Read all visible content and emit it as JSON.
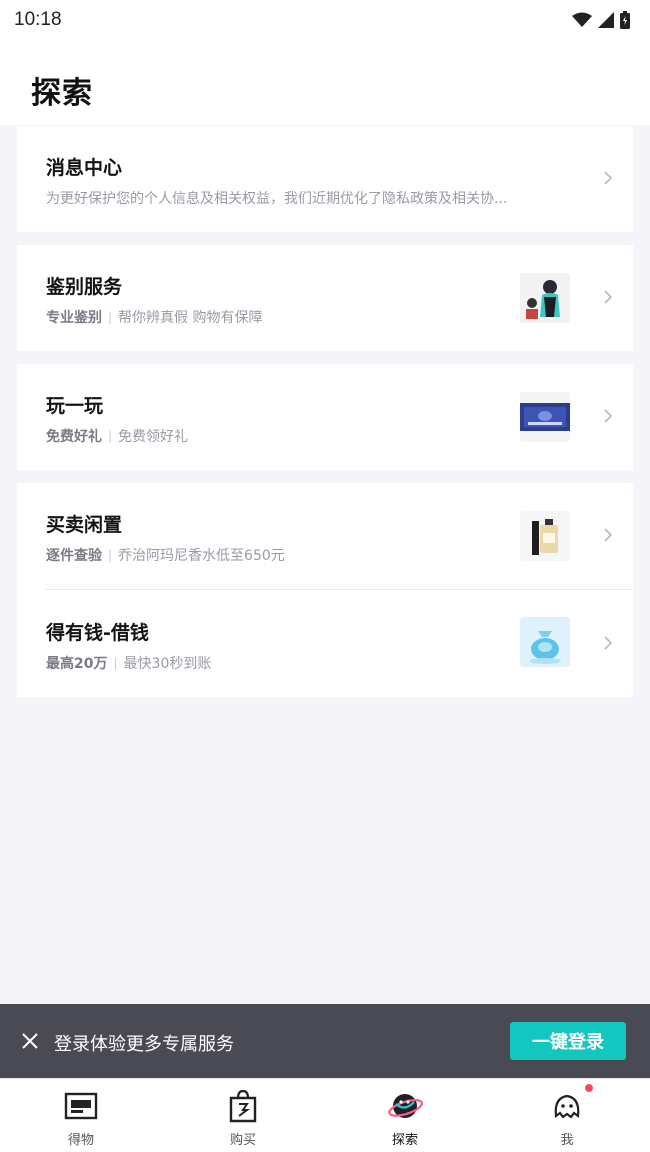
{
  "status_bar": {
    "time": "10:18"
  },
  "header": {
    "title": "探索"
  },
  "rows": [
    {
      "title": "消息中心",
      "subtitle": "为更好保护您的个人信息及相关权益，我们近期优化了隐私政策及相关协...",
      "tag": ""
    },
    {
      "title": "鉴别服务",
      "tag": "专业鉴别",
      "subtitle": "帮你辨真假 购物有保障",
      "thumb": "identify-figure-thumbnail"
    },
    {
      "title": "玩一玩",
      "tag": "免费好礼",
      "subtitle": "免费领好礼",
      "thumb": "game-banner-thumbnail"
    },
    {
      "title": "买卖闲置",
      "tag": "逐件查验",
      "subtitle": "乔治阿玛尼香水低至650元",
      "thumb": "perfume-bottle-thumbnail"
    },
    {
      "title": "得有钱-借钱",
      "tag": "最高20万",
      "subtitle": "最快30秒到账",
      "thumb": "money-bag-thumbnail"
    }
  ],
  "login_banner": {
    "text": "登录体验更多专属服务",
    "button_label": "一键登录"
  },
  "tabbar": {
    "tabs": [
      {
        "label": "得物",
        "icon": "poison-box-icon",
        "active": false
      },
      {
        "label": "购买",
        "icon": "shopping-bag-icon",
        "active": false
      },
      {
        "label": "探索",
        "icon": "planet-icon",
        "active": true
      },
      {
        "label": "我",
        "icon": "ghost-profile-icon",
        "active": false,
        "badge": "dot"
      }
    ]
  },
  "colors": {
    "accent": "#13c6c0",
    "banner_bg": "#4a4a55",
    "page_bg": "#f5f5f9",
    "badge": "#ff4a55"
  }
}
